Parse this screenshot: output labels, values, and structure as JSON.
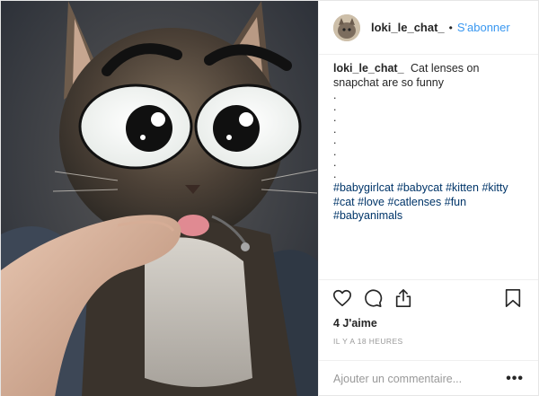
{
  "header": {
    "username": "loki_le_chat_",
    "separator": "•",
    "follow_label": "S'abonner"
  },
  "caption": {
    "username": "loki_le_chat_",
    "text": "Cat lenses on snapchat are so funny",
    "dots": [
      ".",
      ".",
      ".",
      ".",
      ".",
      ".",
      ".",
      "."
    ],
    "hashtags": [
      "#babygirlcat",
      "#babycat",
      "#kitten",
      "#kitty",
      "#cat",
      "#love",
      "#catlenses",
      "#fun",
      "#babyanimals"
    ]
  },
  "actions": {
    "icons": [
      "heart-icon",
      "comment-icon",
      "share-icon",
      "bookmark-icon"
    ]
  },
  "likes": "4 J'aime",
  "timestamp": "IL Y A 18 HEURES",
  "comment": {
    "placeholder": "Ajouter un commentaire...",
    "more_label": "•••"
  },
  "colors": {
    "link_blue": "#3897f0",
    "hashtag_blue": "#003569",
    "border": "#efefef",
    "muted": "#999999"
  }
}
